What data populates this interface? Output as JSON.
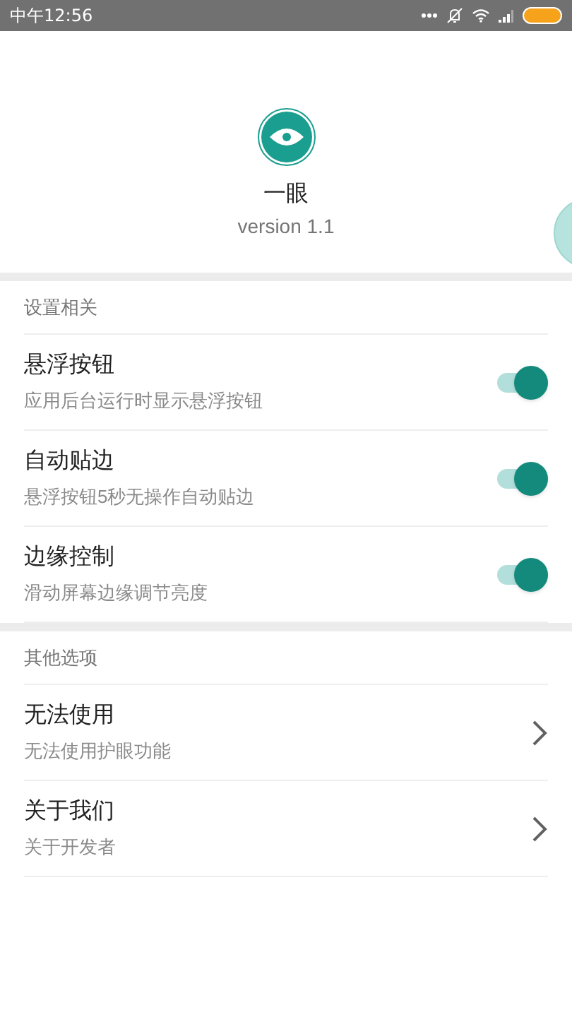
{
  "status_bar": {
    "time": "中午12:56"
  },
  "header": {
    "app_name": "一眼",
    "version": "version 1.1"
  },
  "sections": [
    {
      "title": "设置相关",
      "items": [
        {
          "kind": "toggle",
          "title": "悬浮按钮",
          "subtitle": "应用后台运行时显示悬浮按钮",
          "on": true
        },
        {
          "kind": "toggle",
          "title": "自动贴边",
          "subtitle": "悬浮按钮5秒无操作自动贴边",
          "on": true
        },
        {
          "kind": "toggle",
          "title": "边缘控制",
          "subtitle": "滑动屏幕边缘调节亮度",
          "on": true
        }
      ]
    },
    {
      "title": "其他选项",
      "items": [
        {
          "kind": "link",
          "title": "无法使用",
          "subtitle": "无法使用护眼功能"
        },
        {
          "kind": "link",
          "title": "关于我们",
          "subtitle": "关于开发者"
        }
      ]
    }
  ]
}
